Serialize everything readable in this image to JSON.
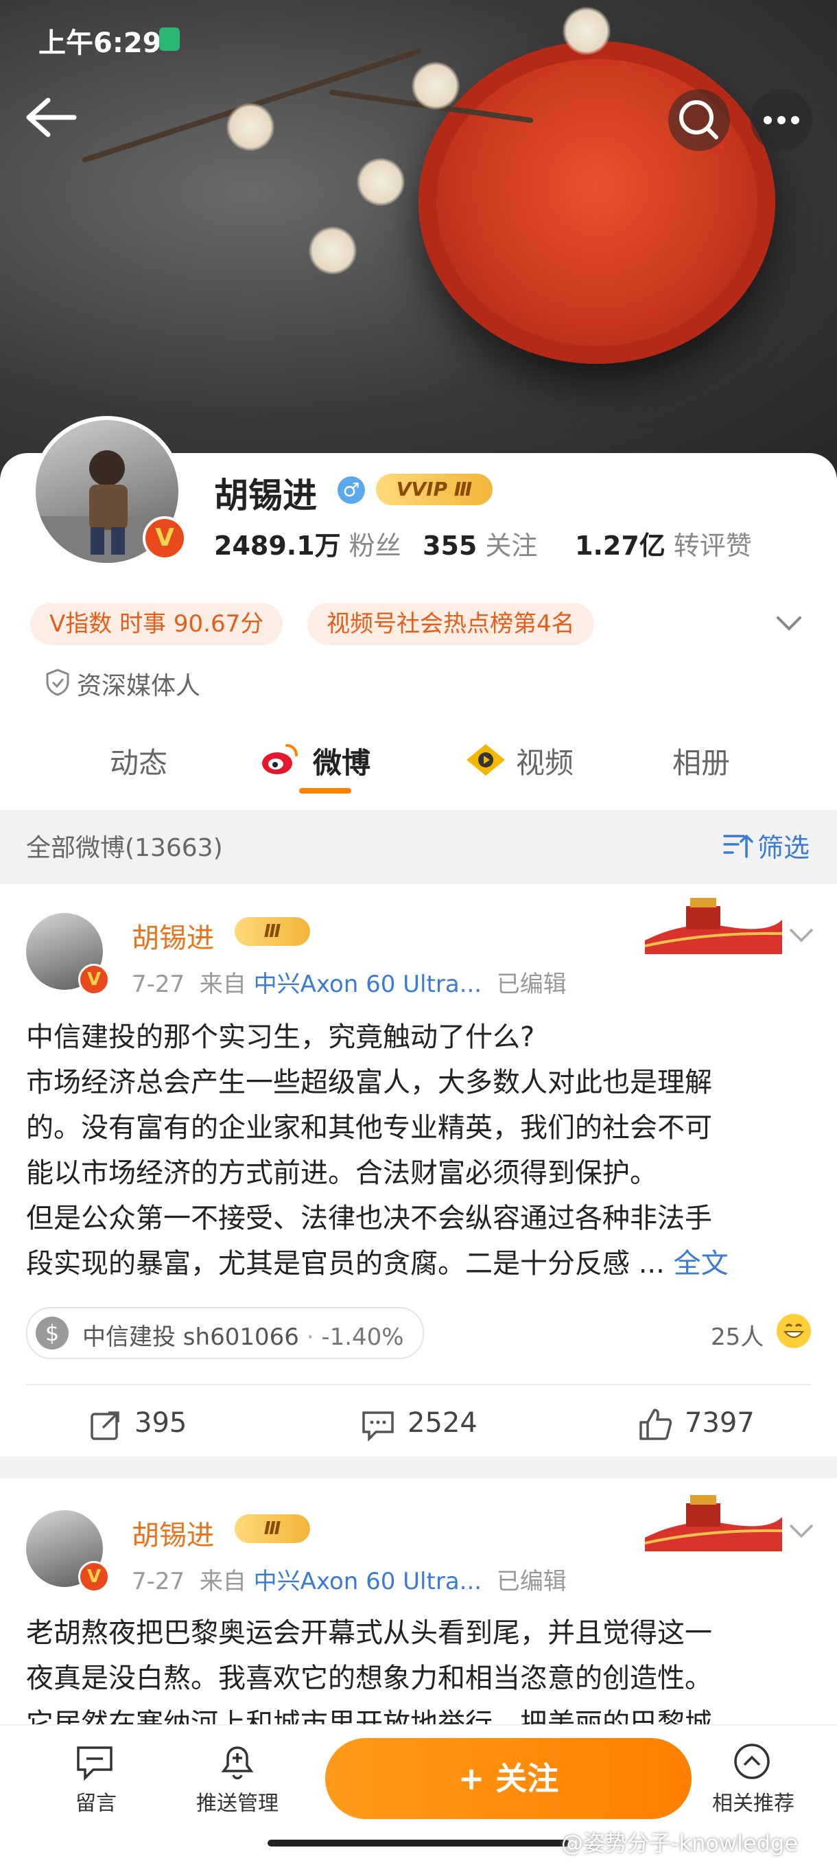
{
  "status_bar": {
    "time": "上午6:29"
  },
  "profile": {
    "name": "胡锡进",
    "vip_label": "VVIP Ⅲ",
    "avatar_badge": "V",
    "followers_value": "2489.1万",
    "followers_label": "粉丝",
    "following_value": "355",
    "following_label": "关注",
    "likes_value": "1.27亿",
    "likes_label": "转评赞",
    "tag_v_index": "V指数 时事 90.67分",
    "tag_ranking": "视频号社会热点榜第4名",
    "verification": "资深媒体人"
  },
  "tabs": [
    {
      "label": "动态"
    },
    {
      "label": "微博"
    },
    {
      "label": "视频"
    },
    {
      "label": "相册"
    }
  ],
  "filter": {
    "count_label": "全部微博(13663)",
    "filter_label": "筛选"
  },
  "posts": [
    {
      "author": "胡锡进",
      "crown": "Ⅲ",
      "date": "7-27",
      "from_label": "来自",
      "source": "中兴Axon 60 Ultra...",
      "edited": "已编辑",
      "lines": [
        "中信建投的那个实习生，究竟触动了什么?",
        "市场经济总会产生一些超级富人，大多数人对此也是理解",
        "的。没有富有的企业家和其他专业精英，我们的社会不可",
        "能以市场经济的方式前进。合法财富必须得到保护。",
        "但是公众第一不接受、法律也决不会纵容通过各种非法手",
        "段实现的暴富，尤其是官员的贪腐。二是十分反感 ..."
      ],
      "more_label": "全文",
      "stock": {
        "symbol_icon": "$",
        "name": "中信建投 sh601066",
        "sep": "·",
        "change": "-1.40%"
      },
      "reaction_count": "25人",
      "reposts": "395",
      "comments": "2524",
      "likes": "7397"
    },
    {
      "author": "胡锡进",
      "crown": "Ⅲ",
      "date": "7-27",
      "from_label": "来自",
      "source": "中兴Axon 60 Ultra...",
      "edited": "已编辑",
      "lines": [
        "老胡熬夜把巴黎奥运会开幕式从头看到尾，并且觉得这一",
        "夜真是没白熬。我喜欢它的想象力和相当恣意的创造性。",
        "它居然在塞纳河上和城市里开放地举行，把美丽的巴黎城"
      ]
    }
  ],
  "bottom_bar": {
    "message_label": "留言",
    "push_label": "推送管理",
    "follow_label": "+ 关注",
    "recommend_label": "相关推荐"
  },
  "watermark": "@姿势分子-knowledge",
  "colors": {
    "accent": "#ff8200",
    "link": "#3a7bd5",
    "name": "#e8731b",
    "badge_red": "#e8491d"
  }
}
